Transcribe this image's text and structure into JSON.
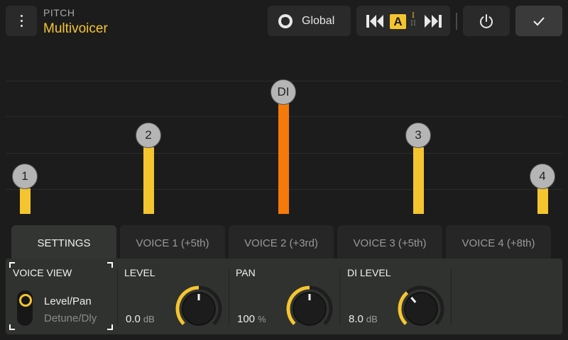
{
  "header": {
    "category": "PITCH",
    "preset_name": "Multivoicer",
    "global_label": "Global",
    "ab_active": "A",
    "ab_second_top": "I",
    "ab_second_bottom": "II"
  },
  "colors": {
    "accent": "#f5c530",
    "di_bar": "#f57a0a",
    "node": "#b5b5b5"
  },
  "icons": [
    "menu-dots-icon",
    "dial-icon",
    "prev-arrow-icon",
    "next-arrow-icon",
    "power-icon",
    "checkmark-icon"
  ],
  "voices": [
    {
      "label": "1",
      "color": "#f5c530"
    },
    {
      "label": "2",
      "color": "#f5c530"
    },
    {
      "label": "DI",
      "color": "#f57a0a"
    },
    {
      "label": "3",
      "color": "#f5c530"
    },
    {
      "label": "4",
      "color": "#f5c530"
    }
  ],
  "tabs": [
    {
      "label": "SETTINGS",
      "active": true
    },
    {
      "label": "VOICE 1 (+5th)",
      "active": false
    },
    {
      "label": "VOICE 2 (+3rd)",
      "active": false
    },
    {
      "label": "VOICE 3 (+5th)",
      "active": false
    },
    {
      "label": "VOICE 4 (+8th)",
      "active": false
    }
  ],
  "voice_view": {
    "title": "VOICE VIEW",
    "selected_option": "Level/Pan",
    "other_option": "Detune/Dly"
  },
  "params": [
    {
      "title": "LEVEL",
      "value": "0.0",
      "unit": "dB",
      "knob_fraction": 0.5
    },
    {
      "title": "PAN",
      "value": "100",
      "unit": "%",
      "knob_fraction": 0.5
    },
    {
      "title": "DI LEVEL",
      "value": "8.0",
      "unit": "dB",
      "knob_fraction": 0.35
    }
  ]
}
